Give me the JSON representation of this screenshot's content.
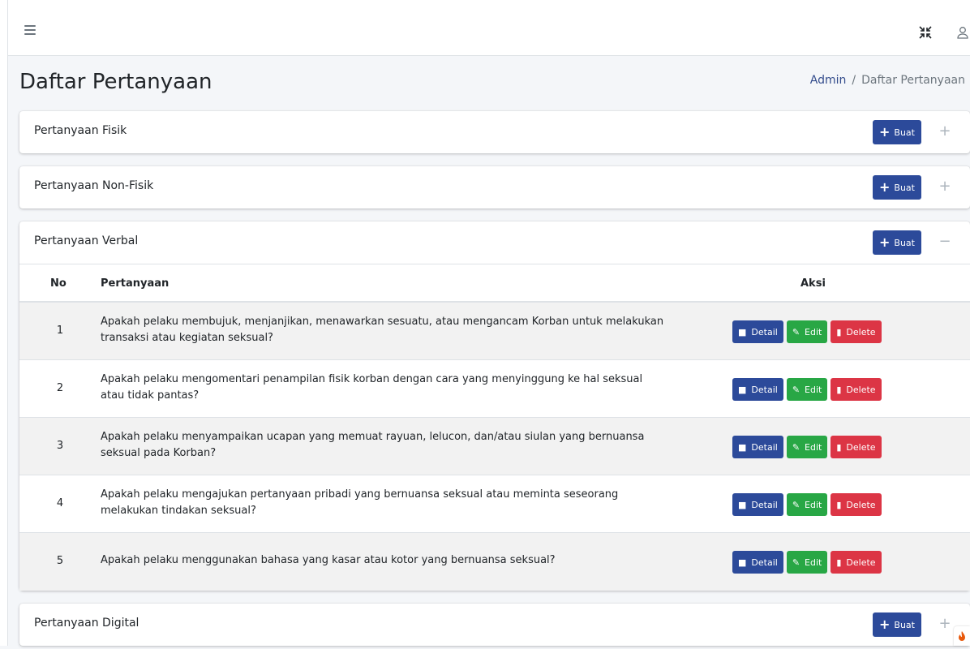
{
  "page": {
    "title": "Daftar Pertanyaan",
    "breadcrumb": {
      "home": "Admin",
      "separator": "/",
      "current": "Daftar Pertanyaan"
    }
  },
  "topbar": {
    "menu_icon": "hamburger-menu-icon",
    "fullscreen_icon": "compress-icon",
    "user_icon": "user-icon"
  },
  "buttons": {
    "create_label": "Buat",
    "detail_label": "Detail",
    "edit_label": "Edit",
    "delete_label": "Delete"
  },
  "colors": {
    "primary": "#2c4a9a",
    "success": "#28a745",
    "danger": "#dc3545",
    "background": "#f4f6f9"
  },
  "cards": {
    "fisik": {
      "title": "Pertanyaan Fisik",
      "tool": "+"
    },
    "nonfisik": {
      "title": "Pertanyaan Non-Fisik",
      "tool": "+"
    },
    "verbal": {
      "title": "Pertanyaan Verbal",
      "tool": "−",
      "columns": {
        "no": "No",
        "question": "Pertanyaan",
        "actions": "Aksi"
      },
      "rows": [
        {
          "no": "1",
          "question": "Apakah pelaku membujuk, menjanjikan, menawarkan sesuatu, atau mengancam Korban untuk melakukan transaksi atau kegiatan seksual?"
        },
        {
          "no": "2",
          "question": "Apakah pelaku mengomentari penampilan fisik korban dengan cara yang menyinggung ke hal seksual atau tidak pantas?"
        },
        {
          "no": "3",
          "question": "Apakah pelaku menyampaikan ucapan yang memuat rayuan, lelucon, dan/atau siulan yang bernuansa seksual pada Korban?"
        },
        {
          "no": "4",
          "question": "Apakah pelaku mengajukan pertanyaan pribadi yang bernuansa seksual atau meminta seseorang melakukan tindakan seksual?"
        },
        {
          "no": "5",
          "question": "Apakah pelaku menggunakan bahasa yang kasar atau kotor yang bernuansa seksual?"
        }
      ]
    },
    "digital": {
      "title": "Pertanyaan Digital",
      "tool": "+"
    }
  }
}
